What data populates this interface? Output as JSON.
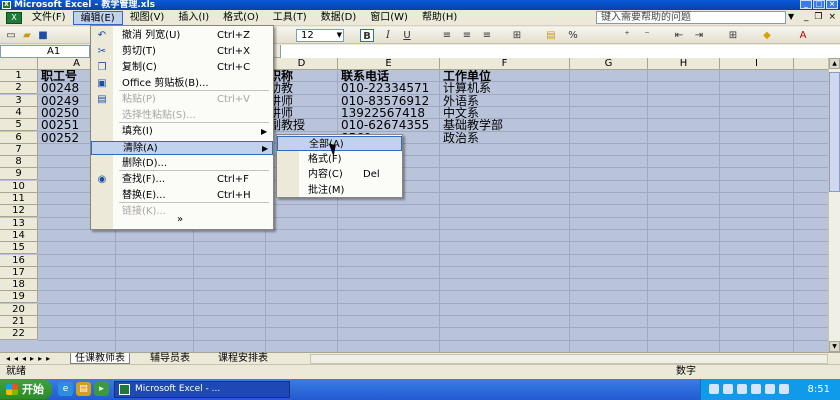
{
  "window": {
    "title": "Microsoft Excel - 教学管理.xls"
  },
  "menubar": {
    "items": [
      "文件(F)",
      "编辑(E)",
      "视图(V)",
      "插入(I)",
      "格式(O)",
      "工具(T)",
      "数据(D)",
      "窗口(W)",
      "帮助(H)"
    ],
    "help_placeholder": "键入需要帮助的问题"
  },
  "toolbar": {
    "font_size": "12",
    "bold": "B",
    "italic": "I",
    "underline": "U",
    "percent": "%"
  },
  "formula": {
    "name_box": "A1"
  },
  "grid": {
    "columns": [
      "A",
      "B",
      "C",
      "D",
      "E",
      "F",
      "G",
      "H",
      "I",
      "J"
    ],
    "rows": [
      "1",
      "2",
      "3",
      "4",
      "5",
      "6",
      "7",
      "8",
      "9",
      "10",
      "11",
      "12",
      "13",
      "14",
      "15",
      "16",
      "17",
      "18",
      "19",
      "20",
      "21",
      "22"
    ],
    "visible_cells": [
      {
        "row": 1,
        "col": "A",
        "text": "职工号"
      },
      {
        "row": 1,
        "col": "D",
        "text": "职称"
      },
      {
        "row": 1,
        "col": "E",
        "text": "联系电话"
      },
      {
        "row": 1,
        "col": "F",
        "text": "工作单位"
      },
      {
        "row": 2,
        "col": "A",
        "text": "00248"
      },
      {
        "row": 2,
        "col": "D",
        "text": "助教"
      },
      {
        "row": 2,
        "col": "E",
        "text": "010-22334571"
      },
      {
        "row": 2,
        "col": "F",
        "text": "计算机系"
      },
      {
        "row": 3,
        "col": "A",
        "text": "00249"
      },
      {
        "row": 3,
        "col": "D",
        "text": "讲师"
      },
      {
        "row": 3,
        "col": "E",
        "text": "010-83576912"
      },
      {
        "row": 3,
        "col": "F",
        "text": "外语系"
      },
      {
        "row": 4,
        "col": "A",
        "text": "00250"
      },
      {
        "row": 4,
        "col": "D",
        "text": "讲师"
      },
      {
        "row": 4,
        "col": "E",
        "text": "13922567418"
      },
      {
        "row": 4,
        "col": "F",
        "text": "中文系"
      },
      {
        "row": 5,
        "col": "A",
        "text": "00251"
      },
      {
        "row": 5,
        "col": "D",
        "text": "副教授"
      },
      {
        "row": 5,
        "col": "E",
        "text": "010-62674355"
      },
      {
        "row": 5,
        "col": "F",
        "text": "基础教学部"
      },
      {
        "row": 6,
        "col": "A",
        "text": "00252"
      },
      {
        "row": 6,
        "col": "E",
        "text": "8569"
      },
      {
        "row": 6,
        "col": "F",
        "text": "政治系"
      }
    ]
  },
  "sheet_tabs": [
    "任课教师表",
    "辅导员表",
    "课程安排表"
  ],
  "status": {
    "left": "就绪",
    "mode": "数字"
  },
  "taskbar": {
    "start": "开始",
    "task": "Microsoft Excel - ...",
    "clock": "8:51"
  },
  "edit_menu": {
    "items": [
      {
        "label": "撤消 列宽(U)",
        "shortcut": "Ctrl+Z",
        "icon": "undo-icon",
        "disabled": false
      },
      {
        "label": "剪切(T)",
        "shortcut": "Ctrl+X",
        "icon": "cut-icon",
        "disabled": false
      },
      {
        "label": "复制(C)",
        "shortcut": "Ctrl+C",
        "icon": "copy-icon",
        "disabled": false
      },
      {
        "label": "Office 剪贴板(B)...",
        "shortcut": "",
        "icon": "clipboard-icon",
        "disabled": false
      },
      {
        "label": "粘贴(P)",
        "shortcut": "Ctrl+V",
        "icon": "paste-icon",
        "disabled": true
      },
      {
        "label": "选择性粘贴(S)...",
        "shortcut": "",
        "icon": "",
        "disabled": true
      },
      {
        "label": "填充(I)",
        "shortcut": "",
        "icon": "",
        "disabled": false,
        "submenu": true
      },
      {
        "label": "清除(A)",
        "shortcut": "",
        "icon": "",
        "disabled": false,
        "submenu": true,
        "highlighted": true
      },
      {
        "label": "删除(D)...",
        "shortcut": "",
        "icon": "",
        "disabled": false
      },
      {
        "label": "查找(F)...",
        "shortcut": "Ctrl+F",
        "icon": "binoculars-icon",
        "disabled": false
      },
      {
        "label": "替换(E)...",
        "shortcut": "Ctrl+H",
        "icon": "",
        "disabled": false
      },
      {
        "label": "链接(K)...",
        "shortcut": "",
        "icon": "",
        "disabled": true
      }
    ],
    "expand": "»"
  },
  "clear_submenu": {
    "items": [
      {
        "label": "全部(A)",
        "shortcut": "",
        "highlighted": true
      },
      {
        "label": "格式(F)",
        "shortcut": ""
      },
      {
        "label": "内容(C)",
        "shortcut": "Del"
      },
      {
        "label": "批注(M)",
        "shortcut": ""
      }
    ]
  },
  "colors": {
    "selection": "#b9c3da",
    "highlight": "#c1d2ee",
    "titlebar": "#0a5ad9"
  }
}
